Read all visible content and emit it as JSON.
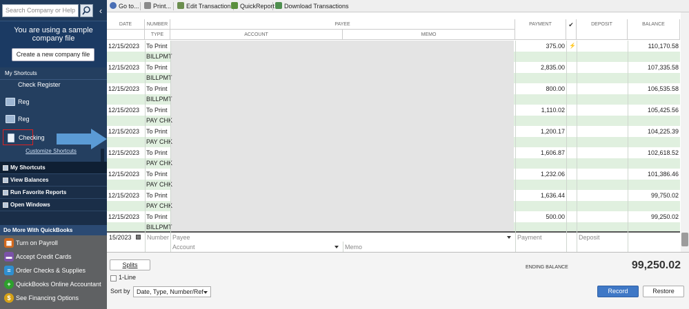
{
  "sidebar": {
    "search_placeholder": "Search Company or Help",
    "collapse_glyph": "‹",
    "sample_text": "You are using a sample company file",
    "create_button": "Create a new company file",
    "shortcuts_header": "My Shortcuts",
    "shortcut_items": [
      {
        "label": "Check Register",
        "icon": "none"
      },
      {
        "label": "Reg",
        "icon": "register-icon"
      },
      {
        "label": "Reg",
        "icon": "register-icon"
      },
      {
        "label": "Checking",
        "icon": "document-icon"
      }
    ],
    "customize_link": "Customize Shortcuts",
    "nav_items": [
      "My Shortcuts",
      "View Balances",
      "Run Favorite Reports",
      "Open Windows"
    ],
    "do_more_header": "Do More With QuickBooks",
    "do_more_items": [
      {
        "label": "Turn on Payroll",
        "icon": "payroll-icon",
        "color": "#d2691e"
      },
      {
        "label": "Accept Credit Cards",
        "icon": "credit-card-icon",
        "color": "#7b52a8"
      },
      {
        "label": "Order Checks & Supplies",
        "icon": "checks-icon",
        "color": "#2f8fcf"
      },
      {
        "label": "QuickBooks Online Accountant",
        "icon": "plus-icon",
        "color": "#2ca02c"
      },
      {
        "label": "See Financing Options",
        "icon": "dollar-icon",
        "color": "#d4a017"
      }
    ]
  },
  "toolbar": {
    "goto": "Go to...",
    "print": "Print...",
    "edit": "Edit Transaction",
    "quickreport": "QuickReport",
    "download": "Download Transactions"
  },
  "register": {
    "headers": {
      "date": "DATE",
      "number": "NUMBER",
      "type": "TYPE",
      "payee": "PAYEE",
      "account": "ACCOUNT",
      "memo": "MEMO",
      "payment": "PAYMENT",
      "check": "✔",
      "deposit": "DEPOSIT",
      "balance": "BALANCE"
    },
    "rows": [
      {
        "date": "12/15/2023",
        "number": "To Print",
        "type": "BILLPMT",
        "payment": "375.00",
        "cleared": "⚡",
        "balance": "110,170.58"
      },
      {
        "date": "12/15/2023",
        "number": "To Print",
        "type": "BILLPMT",
        "payment": "2,835.00",
        "cleared": "",
        "balance": "107,335.58"
      },
      {
        "date": "12/15/2023",
        "number": "To Print",
        "type": "BILLPMT",
        "payment": "800.00",
        "cleared": "",
        "balance": "106,535.58"
      },
      {
        "date": "12/15/2023",
        "number": "To Print",
        "type": "PAY CHK",
        "payment": "1,110.02",
        "cleared": "",
        "balance": "105,425.56"
      },
      {
        "date": "12/15/2023",
        "number": "To Print",
        "type": "PAY CHK",
        "payment": "1,200.17",
        "cleared": "",
        "balance": "104,225.39"
      },
      {
        "date": "12/15/2023",
        "number": "To Print",
        "type": "PAY CHK",
        "payment": "1,606.87",
        "cleared": "",
        "balance": "102,618.52"
      },
      {
        "date": "12/15/2023",
        "number": "To Print",
        "type": "PAY CHK",
        "payment": "1,232.06",
        "cleared": "",
        "balance": "101,386.46"
      },
      {
        "date": "12/15/2023",
        "number": "To Print",
        "type": "PAY CHK",
        "payment": "1,636.44",
        "cleared": "",
        "balance": "99,750.02"
      },
      {
        "date": "12/15/2023",
        "number": "To Print",
        "type": "BILLPMT",
        "payment": "500.00",
        "cleared": "",
        "balance": "99,250.02"
      }
    ],
    "entry": {
      "date": "15/2023",
      "number_placeholder": "Number",
      "payee_placeholder": "Payee",
      "account_placeholder": "Account",
      "memo_placeholder": "Memo",
      "payment_placeholder": "Payment",
      "deposit_placeholder": "Deposit"
    }
  },
  "footer": {
    "splits": "Splits",
    "one_line": "1-Line",
    "sort_by_label": "Sort by",
    "sort_by_value": "Date, Type, Number/Ref",
    "ending_balance_label": "ENDING BALANCE",
    "ending_balance_value": "99,250.02",
    "record": "Record",
    "restore": "Restore"
  },
  "colors": {
    "sidebar_bg": "#1f3a5b",
    "row_alt": "#e0f0df",
    "record_btn": "#3f78c6",
    "highlight_border": "#dd2222",
    "arrow": "#5b9bd5"
  }
}
